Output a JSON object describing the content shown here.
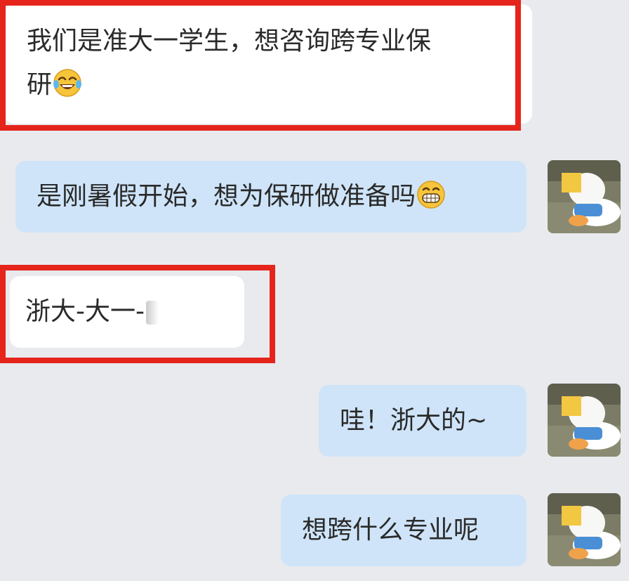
{
  "chat": {
    "messages": [
      {
        "side": "left",
        "text_line1": "我们是准大一学生，想咨询跨专业保",
        "text_line2": "研",
        "emoji": "tears-of-joy-emoji",
        "highlighted": true
      },
      {
        "side": "right",
        "text": "是刚暑假开始，想为保研做准备吗",
        "emoji": "grin-emoji",
        "avatar": "plush-toy-avatar"
      },
      {
        "side": "left",
        "text": "浙大-大一-",
        "redacted": true,
        "highlighted": true
      },
      {
        "side": "right",
        "text": "哇！浙大的~",
        "avatar": "plush-toy-avatar"
      },
      {
        "side": "right",
        "text": "想跨什么专业呢",
        "avatar": "plush-toy-avatar"
      }
    ]
  },
  "colors": {
    "background": "#e9eaee",
    "incoming_bubble": "#ffffff",
    "outgoing_bubble": "#cfe4f8",
    "highlight_box": "#e5241b",
    "text": "#2a2a2a"
  }
}
